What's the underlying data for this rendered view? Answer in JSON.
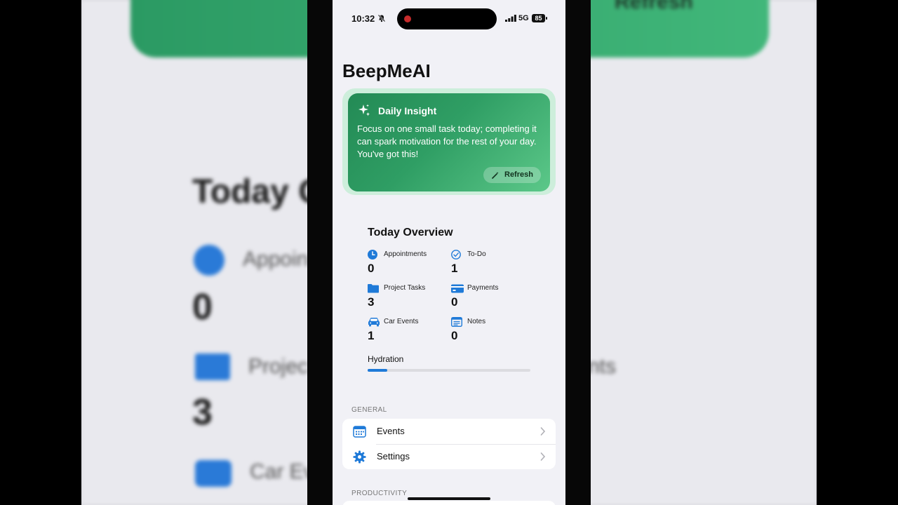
{
  "status": {
    "time": "10:32",
    "network": "5G",
    "battery": "85"
  },
  "app": {
    "title": "BeepMeAI"
  },
  "insight": {
    "title": "Daily Insight",
    "message": "Focus on one small task today; completing it can spark motivation for the rest of your day. You've got this!",
    "refresh_label": "Refresh"
  },
  "overview": {
    "title": "Today Overview",
    "stats": [
      {
        "label": "Appointments",
        "value": "0",
        "icon": "clock-icon"
      },
      {
        "label": "To-Do",
        "value": "1",
        "icon": "check-circle-icon"
      },
      {
        "label": "Project Tasks",
        "value": "3",
        "icon": "folder-icon"
      },
      {
        "label": "Payments",
        "value": "0",
        "icon": "card-icon"
      },
      {
        "label": "Car Events",
        "value": "1",
        "icon": "car-icon"
      },
      {
        "label": "Notes",
        "value": "0",
        "icon": "notes-icon"
      }
    ],
    "hydration": {
      "label": "Hydration",
      "progress": 0.12
    }
  },
  "sections": {
    "general": {
      "header": "GENERAL",
      "items": [
        {
          "label": "Events",
          "icon": "calendar-icon"
        },
        {
          "label": "Settings",
          "icon": "gear-icon"
        }
      ]
    },
    "productivity": {
      "header": "PRODUCTIVITY"
    }
  },
  "background": {
    "refresh": "Refresh",
    "today_partial": "Today O",
    "appoin_partial": "Appoin",
    "num0": "0",
    "proje_partial": "Projec",
    "nts_partial": "nts",
    "num3": "3",
    "car_partial": "Car Ev"
  },
  "colors": {
    "accent": "#1f7ad8",
    "insight_start": "#238a55",
    "insight_end": "#5cc889"
  }
}
